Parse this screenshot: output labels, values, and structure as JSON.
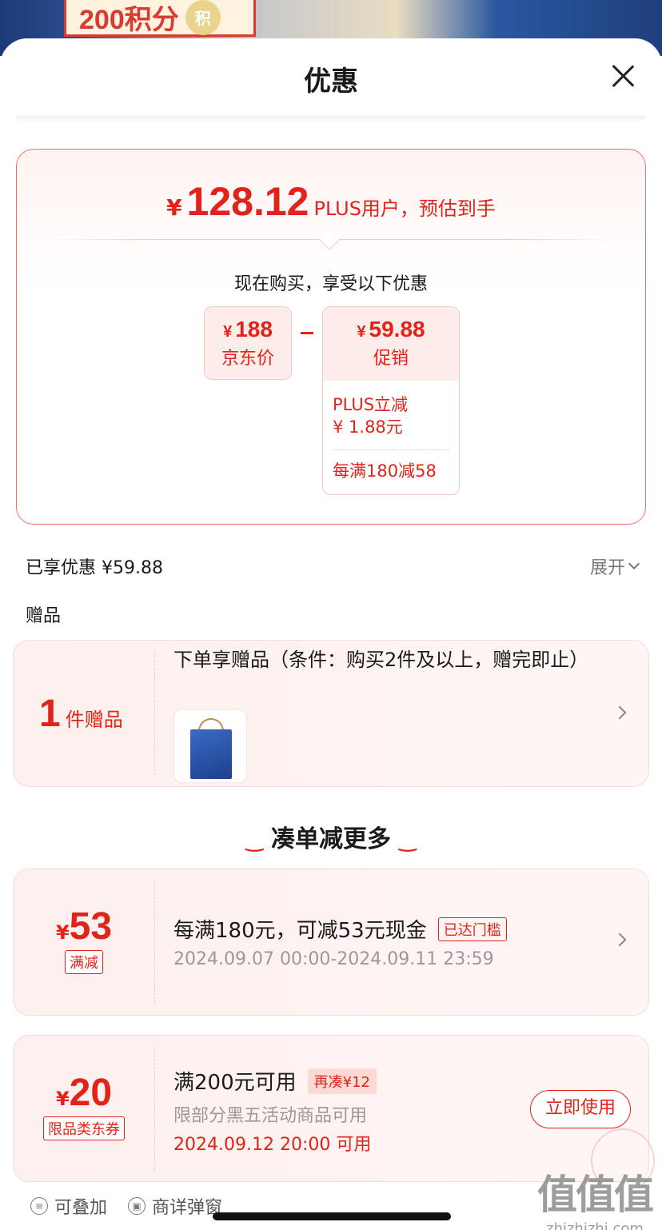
{
  "background_banner": {
    "text": "200积分",
    "coin": "积"
  },
  "header": {
    "title": "优惠"
  },
  "price_card": {
    "yen": "¥",
    "final_price": "128.12",
    "final_desc": "PLUS用户，预估到手",
    "buy_now_text": "现在购买，享受以下优惠",
    "jd_price": {
      "yen": "¥",
      "value": "188",
      "label": "京东价"
    },
    "promo": {
      "yen": "¥",
      "value": "59.88",
      "label": "促销"
    },
    "promo_details": [
      "PLUS立减",
      "¥ 1.88元",
      "每满180减58"
    ]
  },
  "enjoyed": {
    "label": "已享优惠 ¥59.88",
    "expand": "展开"
  },
  "gift_section": {
    "title": "赠品",
    "count": "1",
    "unit": "件赠品",
    "description": "下单享赠品（条件：购买2件及以上，赠完即止）"
  },
  "more_section": {
    "title": "凑单减更多"
  },
  "coupons": [
    {
      "yen": "¥",
      "amount": "53",
      "tag": "满减",
      "title": "每满180元，可减53元现金",
      "badge": "已达门槛",
      "time": "2024.09.07 00:00-2024.09.11 23:59"
    },
    {
      "yen": "¥",
      "amount": "20",
      "tag": "限品类东券",
      "title": "满200元可用",
      "badge": "再凑¥12",
      "scope": "限部分黑五活动商品可用",
      "time": "2024.09.12 20:00 可用",
      "button": "立即使用"
    }
  ],
  "bottom_bar": {
    "stackable": "可叠加",
    "popup": "商详弹窗"
  },
  "watermark": {
    "big": "值值值",
    "small": "zhizhizhi.com"
  },
  "colors": {
    "accent": "#e2231a",
    "card_bg": "#fdf0ee"
  }
}
